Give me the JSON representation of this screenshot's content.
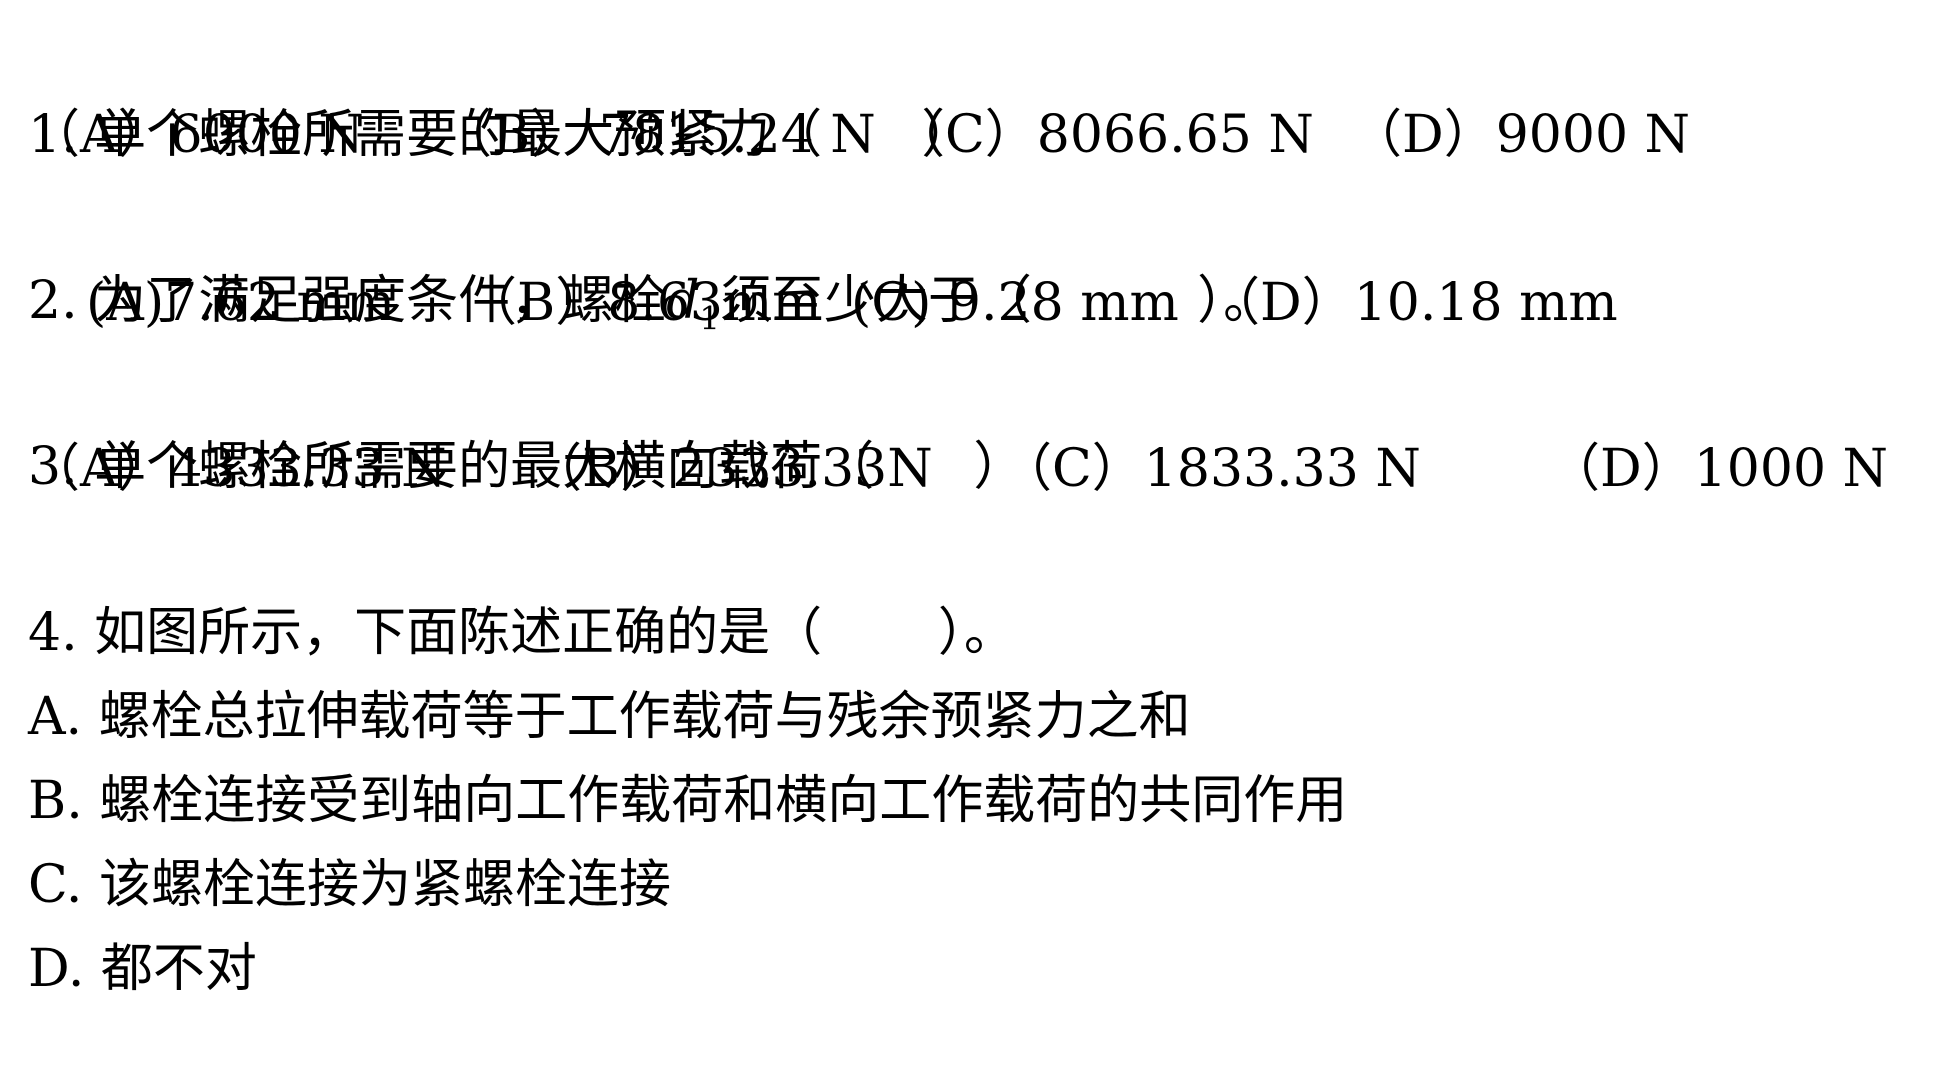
{
  "questions": [
    {
      "stem": "1. 单个螺栓所需要的最大预紧力（      ）",
      "options": [
        "（A）6000 N",
        "（B） 7815.24 N",
        "（C）8066.65 N",
        "（D）9000 N"
      ]
    },
    {
      "stem_before": "2. 为了满足强度条件，螺栓",
      "stem_var": "d",
      "stem_sub": "1",
      "stem_after": "须至少大于（          ）。",
      "options": [
        "(A)7.62 mm",
        "（B）8.63mm",
        "(C) 9.28 mm",
        "（D）10.18 mm"
      ]
    },
    {
      "stem": "3. 单个螺栓所需要的最大横向载荷（      ）",
      "options": [
        "（A）4333.33 N",
        "（B）2333.33N",
        "（C）1833.33 N",
        "（D）1000 N"
      ]
    },
    {
      "stem": "4. 如图所示，下面陈述正确的是（       ）。",
      "options": [
        "A. 螺栓总拉伸载荷等于工作载荷与残余预紧力之和",
        "B. 螺栓连接受到轴向工作载荷和横向工作载荷的共同作用",
        "C. 该螺栓连接为紧螺栓连接",
        "D. 都不对"
      ]
    }
  ]
}
